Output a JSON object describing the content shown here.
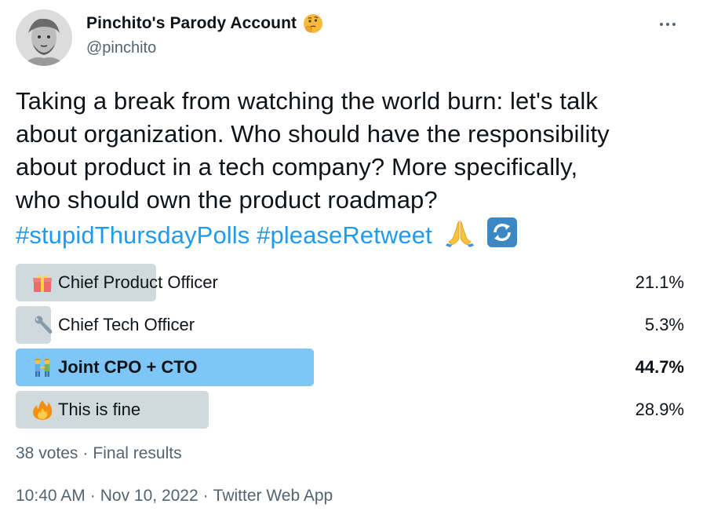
{
  "author": {
    "display_name": "Pinchito's Parody Account",
    "handle": "@pinchito",
    "name_emoji_icon": "thinking-face-icon"
  },
  "tweet": {
    "text_lines": [
      "Taking a break from watching the world burn: let's talk",
      "about organization. Who should have the responsibility",
      "about product in a tech company? More specifically,",
      "who should own the product roadmap?"
    ],
    "hashtags": [
      "#stupidThursdayPolls",
      "#pleaseRetweet"
    ],
    "trailing_emoji_icons": [
      "folded-hands-icon",
      "repeat-arrows-icon"
    ]
  },
  "poll": {
    "options": [
      {
        "label": "Chief Product Officer",
        "percent": "21.1%",
        "fraction": 0.211,
        "icon": "gift-icon",
        "winner": false
      },
      {
        "label": "Chief Tech Officer",
        "percent": "5.3%",
        "fraction": 0.053,
        "icon": "wrench-icon",
        "winner": false
      },
      {
        "label": "Joint CPO + CTO",
        "percent": "44.7%",
        "fraction": 0.447,
        "icon": "two-people-icon",
        "winner": true
      },
      {
        "label": "This is fine",
        "percent": "28.9%",
        "fraction": 0.289,
        "icon": "fire-icon",
        "winner": false
      }
    ],
    "votes": "38 votes",
    "status": "Final results",
    "separator": "·"
  },
  "meta": {
    "time": "10:40 AM",
    "date": "Nov 10, 2022",
    "source": "Twitter Web App",
    "separator": "·"
  },
  "colors": {
    "text": "#0f1419",
    "secondary": "#536471",
    "link": "#1d9bf0",
    "bar": "#cfd9de",
    "bar_winner": "#7ec6f6"
  }
}
